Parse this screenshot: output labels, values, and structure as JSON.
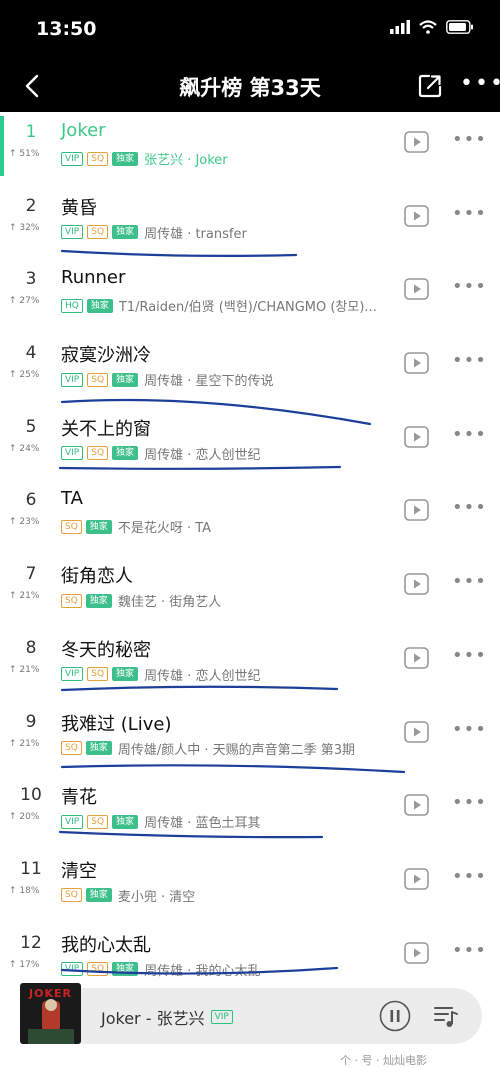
{
  "status": {
    "time": "13:50"
  },
  "header": {
    "title": "飙升榜 第33天"
  },
  "colors": {
    "accent": "#3ec88a",
    "ink": "#1d3f9a"
  },
  "songs": [
    {
      "rank": "1",
      "trend": "51%",
      "title": "Joker",
      "badges": [
        "VIP",
        "SQ",
        "独家"
      ],
      "meta": "张艺兴 · Joker",
      "active": true
    },
    {
      "rank": "2",
      "trend": "32%",
      "title": "黄昏",
      "badges": [
        "VIP",
        "SQ",
        "独家"
      ],
      "meta": "周传雄 · transfer"
    },
    {
      "rank": "3",
      "trend": "27%",
      "title": "Runner",
      "badges": [
        "HQ",
        "独家"
      ],
      "meta": "T1/Raiden/伯贤 (백현)/CHANGMO (창모)..."
    },
    {
      "rank": "4",
      "trend": "25%",
      "title": "寂寞沙洲冷",
      "badges": [
        "VIP",
        "SQ",
        "独家"
      ],
      "meta": "周传雄 · 星空下的传说"
    },
    {
      "rank": "5",
      "trend": "24%",
      "title": "关不上的窗",
      "badges": [
        "VIP",
        "SQ",
        "独家"
      ],
      "meta": "周传雄 · 恋人创世纪"
    },
    {
      "rank": "6",
      "trend": "23%",
      "title": "TA",
      "badges": [
        "SQ",
        "独家"
      ],
      "meta": "不是花火呀 · TA"
    },
    {
      "rank": "7",
      "trend": "21%",
      "title": "街角恋人",
      "badges": [
        "SQ",
        "独家"
      ],
      "meta": "魏佳艺 · 街角艺人"
    },
    {
      "rank": "8",
      "trend": "21%",
      "title": "冬天的秘密",
      "badges": [
        "VIP",
        "SQ",
        "独家"
      ],
      "meta": "周传雄 · 恋人创世纪"
    },
    {
      "rank": "9",
      "trend": "21%",
      "title": "我难过 (Live)",
      "badges": [
        "SQ",
        "独家"
      ],
      "meta": "周传雄/颜人中 · 天赐的声音第二季 第3期"
    },
    {
      "rank": "10",
      "trend": "20%",
      "title": "青花",
      "badges": [
        "VIP",
        "SQ",
        "独家"
      ],
      "meta": "周传雄 · 蓝色土耳其"
    },
    {
      "rank": "11",
      "trend": "18%",
      "title": "清空",
      "badges": [
        "SQ",
        "独家"
      ],
      "meta": "麦小兜 · 清空"
    },
    {
      "rank": "12",
      "trend": "17%",
      "title": "我的心太乱",
      "badges": [
        "VIP",
        "SQ",
        "独家"
      ],
      "meta": "周传雄 · 我的心太乱"
    }
  ],
  "player": {
    "cover_text": "JOKER",
    "now_playing": "Joker - 张艺兴",
    "badge": "VIP"
  },
  "watermark": "个 · 号 · 灿灿电影"
}
